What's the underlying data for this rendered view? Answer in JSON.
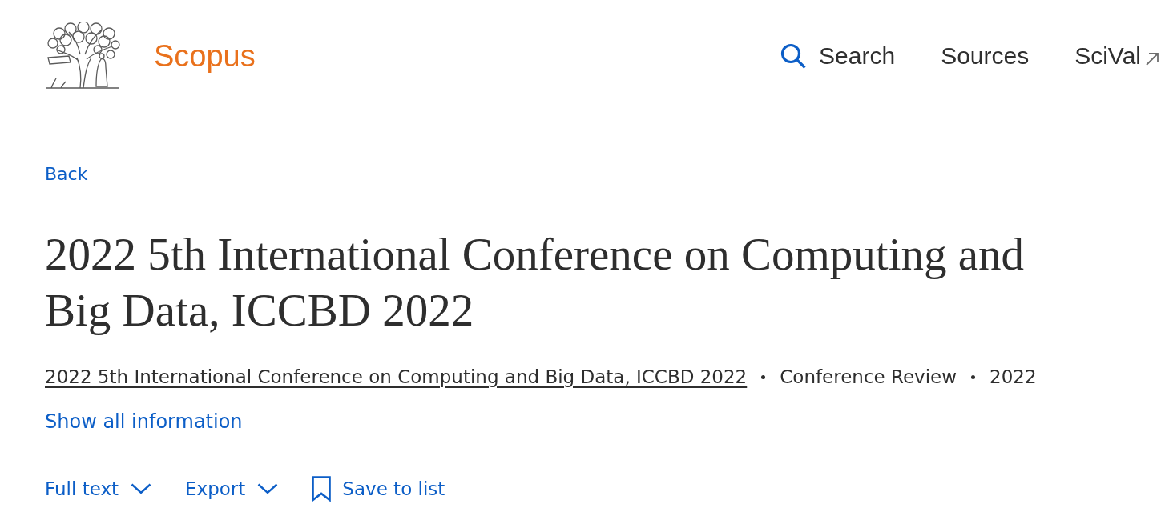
{
  "header": {
    "brand": "Scopus",
    "nav": [
      {
        "label": "Search",
        "kind": "search"
      },
      {
        "label": "Sources",
        "kind": "plain"
      },
      {
        "label": "SciVal",
        "kind": "external"
      }
    ]
  },
  "back_link": "Back",
  "title": "2022 5th International Conference on Computing and Big Data, ICCBD 2022",
  "meta": {
    "source": "2022 5th International Conference on Computing and Big Data, ICCBD 2022",
    "document_type": "Conference Review",
    "year": "2022"
  },
  "show_all_link": "Show all information",
  "actions": [
    {
      "label": "Full text",
      "kind": "dropdown"
    },
    {
      "label": "Export",
      "kind": "dropdown"
    },
    {
      "label": "Save to list",
      "kind": "bookmark"
    }
  ]
}
